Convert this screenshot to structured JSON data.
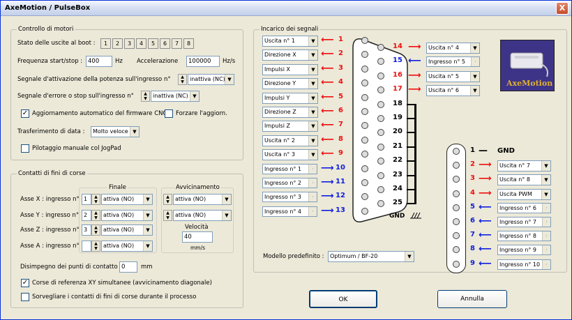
{
  "window": {
    "title": "AxeMotion / PulseBox",
    "close_label": "X"
  },
  "motor": {
    "group_title": "Controllo di motori",
    "boot_label": "Stato delle uscite al boot :",
    "boot_bits": [
      "1",
      "2",
      "3",
      "4",
      "5",
      "6",
      "7",
      "8"
    ],
    "freq_label": "Frequenza start/stop :",
    "freq_value": "400",
    "freq_unit": "Hz",
    "accel_label": "Accelerazione",
    "accel_value": "100000",
    "accel_unit": "Hz/s",
    "power_label": "Segnale d'attivazione della potenza sull'ingresso n°",
    "power_value": "inattiva (NC)",
    "error_label": "Segnale d'errore o stop sull'ingresso n°",
    "error_value": "inattiva (NC)",
    "fw_label": "Aggiornamento automatico del firmware CNC",
    "fw_checked": "✓",
    "force_label": "Forzare l'aggiorn.",
    "transfer_label": "Trasferimento di data :",
    "transfer_value": "Molto veloce",
    "jog_label": "Pilotaggio manuale col JogPad"
  },
  "limits": {
    "group_title": "Contatti di fini di corse",
    "finale_title": "Finale",
    "avv_title": "Avvicinamento",
    "axes": [
      {
        "label": "Asse X :  ingresso n°",
        "num": "1",
        "finale": "attiva (NO)",
        "avv": "attiva (NO)"
      },
      {
        "label": "Asse Y :  ingresso n°",
        "num": "2",
        "finale": "attiva (NO)",
        "avv": "attiva (NO)"
      },
      {
        "label": "Asse Z :  ingresso n°",
        "num": "3",
        "finale": "attiva (NO)",
        "avv": ""
      },
      {
        "label": "Asse A :  ingresso n°",
        "num": "",
        "finale": "attiva (NO)",
        "avv": ""
      }
    ],
    "speed_label": "Velocità",
    "speed_value": "40",
    "speed_unit": "mm/s",
    "disengage_label": "Disimpegno dei punti di contatto :",
    "disengage_value": "0",
    "disengage_unit": "mm",
    "ref_label": "Corse di referenza XY simultanee (avvicinamento diagonale)",
    "ref_checked": "✓",
    "monitor_label": "Sorvegliare i contatti di fini di corse durante il processo"
  },
  "signals": {
    "group_title": "Incarico dei segnali",
    "left_outputs": [
      "Uscita n° 1",
      "Direzione X",
      "Impulsi X",
      "Direzione Y",
      "Impulsi Y",
      "Direzione Z",
      "Impulsi Z",
      "Uscita n° 2",
      "Uscita n° 3"
    ],
    "left_inputs": [
      "Ingresso n° 1",
      "Ingresso n° 2",
      "Ingresso n° 3",
      "Ingresso n° 4"
    ],
    "left_pins": [
      "1",
      "2",
      "3",
      "4",
      "5",
      "6",
      "7",
      "8",
      "9",
      "10",
      "11",
      "12",
      "13"
    ],
    "right_pins": [
      "14",
      "15",
      "16",
      "17",
      "18",
      "19",
      "20",
      "21",
      "22",
      "23",
      "24",
      "25"
    ],
    "right_fields": [
      "Uscita n° 4",
      "Ingresso n° 5",
      "Uscita n° 5",
      "Uscita n° 6"
    ],
    "gnd_label": "GND",
    "model_label": "Modello predefinito :",
    "model_value": "Optimum / BF-20",
    "logo_text": "AxeMotion",
    "conn2_pins": [
      "1",
      "2",
      "3",
      "4",
      "5",
      "6",
      "7",
      "8",
      "9"
    ],
    "conn2_fields": [
      "Uscita n° 7",
      "Uscita n° 8",
      "Uscita PWM",
      "Ingresso n° 6",
      "Ingresso n° 7",
      "Ingresso n° 8",
      "Ingresso n° 9",
      "Ingresso n° 10"
    ],
    "conn2_gnd": "GND"
  },
  "buttons": {
    "ok": "OK",
    "cancel": "Annulla"
  }
}
